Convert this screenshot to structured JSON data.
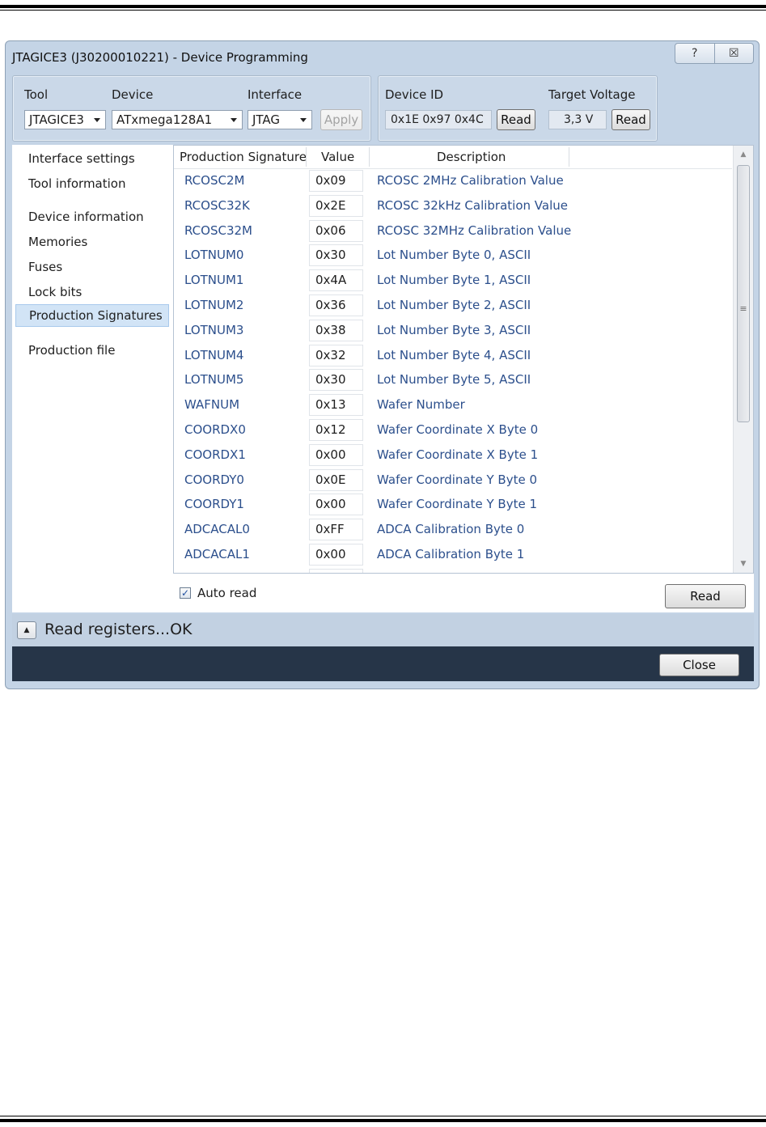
{
  "window": {
    "title": "JTAGICE3 (J30200010221) - Device Programming",
    "help_glyph": "?",
    "close_glyph": "☒"
  },
  "toolbar": {
    "tool_label": "Tool",
    "tool_value": "JTAGICE3",
    "device_label": "Device",
    "device_value": "ATxmega128A1",
    "interface_label": "Interface",
    "interface_value": "JTAG",
    "apply_label": "Apply",
    "device_id_label": "Device ID",
    "device_id_value": "0x1E 0x97 0x4C",
    "device_id_read": "Read",
    "target_voltage_label": "Target Voltage",
    "target_voltage_value": "3,3 V",
    "target_voltage_read": "Read"
  },
  "sidebar": {
    "items": [
      {
        "label": "Interface settings"
      },
      {
        "label": "Tool information"
      },
      {
        "label": "Device information"
      },
      {
        "label": "Memories"
      },
      {
        "label": "Fuses"
      },
      {
        "label": "Lock bits"
      },
      {
        "label": "Production Signatures",
        "selected": true
      },
      {
        "label": "Production file"
      }
    ]
  },
  "table": {
    "columns": [
      "Production Signature",
      "Value",
      "Description"
    ],
    "rows": [
      {
        "name": "RCOSC2M",
        "value": "0x09",
        "desc": "RCOSC 2MHz Calibration Value"
      },
      {
        "name": "RCOSC32K",
        "value": "0x2E",
        "desc": "RCOSC 32kHz Calibration Value"
      },
      {
        "name": "RCOSC32M",
        "value": "0x06",
        "desc": "RCOSC 32MHz Calibration Value"
      },
      {
        "name": "LOTNUM0",
        "value": "0x30",
        "desc": "Lot Number Byte 0, ASCII"
      },
      {
        "name": "LOTNUM1",
        "value": "0x4A",
        "desc": "Lot Number Byte 1, ASCII"
      },
      {
        "name": "LOTNUM2",
        "value": "0x36",
        "desc": "Lot Number Byte 2, ASCII"
      },
      {
        "name": "LOTNUM3",
        "value": "0x38",
        "desc": "Lot Number Byte 3, ASCII"
      },
      {
        "name": "LOTNUM4",
        "value": "0x32",
        "desc": "Lot Number Byte 4, ASCII"
      },
      {
        "name": "LOTNUM5",
        "value": "0x30",
        "desc": "Lot Number Byte 5, ASCII"
      },
      {
        "name": "WAFNUM",
        "value": "0x13",
        "desc": "Wafer Number"
      },
      {
        "name": "COORDX0",
        "value": "0x12",
        "desc": "Wafer Coordinate X Byte 0"
      },
      {
        "name": "COORDX1",
        "value": "0x00",
        "desc": "Wafer Coordinate X Byte 1"
      },
      {
        "name": "COORDY0",
        "value": "0x0E",
        "desc": "Wafer Coordinate Y Byte 0"
      },
      {
        "name": "COORDY1",
        "value": "0x00",
        "desc": "Wafer Coordinate Y Byte 1"
      },
      {
        "name": "ADCACAL0",
        "value": "0xFF",
        "desc": "ADCA Calibration Byte 0"
      },
      {
        "name": "ADCACAL1",
        "value": "0x00",
        "desc": "ADCA Calibration Byte 1"
      }
    ]
  },
  "bottom": {
    "auto_read_label": "Auto read",
    "auto_read_checked": true,
    "read_label": "Read"
  },
  "status": {
    "text": "Read registers...OK"
  },
  "footer": {
    "close_label": "Close"
  },
  "colors": {
    "row_text": "#2c4f8c",
    "frame": "#c4d4e6",
    "footer": "#263548"
  }
}
